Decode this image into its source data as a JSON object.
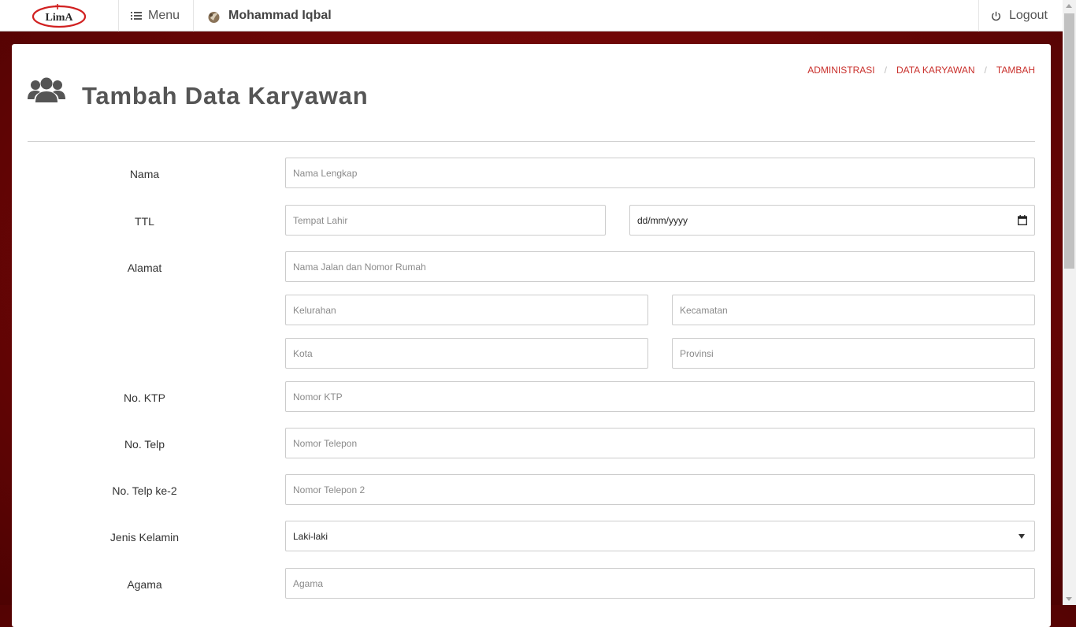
{
  "navbar": {
    "brand_text": "LimA",
    "menu_label": "Menu",
    "user_name": "Mohammad Iqbal",
    "logout_label": "Logout"
  },
  "header": {
    "title": "Tambah Data Karyawan",
    "breadcrumb": [
      "ADMINISTRASI",
      "DATA KARYAWAN",
      "TAMBAH"
    ],
    "breadcrumb_separator": "/"
  },
  "form": {
    "nama": {
      "label": "Nama",
      "placeholder": "Nama Lengkap"
    },
    "ttl": {
      "label": "TTL",
      "placeholder": "Tempat Lahir",
      "date_value": "dd/mm/yyyy"
    },
    "alamat": {
      "label": "Alamat",
      "street_placeholder": "Nama Jalan dan Nomor Rumah",
      "kelurahan_placeholder": "Kelurahan",
      "kecamatan_placeholder": "Kecamatan",
      "kota_placeholder": "Kota",
      "provinsi_placeholder": "Provinsi"
    },
    "ktp": {
      "label": "No. KTP",
      "placeholder": "Nomor KTP"
    },
    "telp": {
      "label": "No. Telp",
      "placeholder": "Nomor Telepon"
    },
    "telp2": {
      "label": "No. Telp ke-2",
      "placeholder": "Nomor Telepon 2"
    },
    "gender": {
      "label": "Jenis Kelamin",
      "value": "Laki-laki"
    },
    "agama": {
      "label": "Agama",
      "placeholder": "Agama"
    }
  },
  "colors": {
    "background": "#6e0606",
    "accent": "#c9302c",
    "title": "#555555"
  },
  "icons": {
    "menu": "list-icon",
    "logout": "power-icon",
    "title": "users-icon",
    "date": "calendar-icon",
    "select": "caret-down-icon"
  }
}
